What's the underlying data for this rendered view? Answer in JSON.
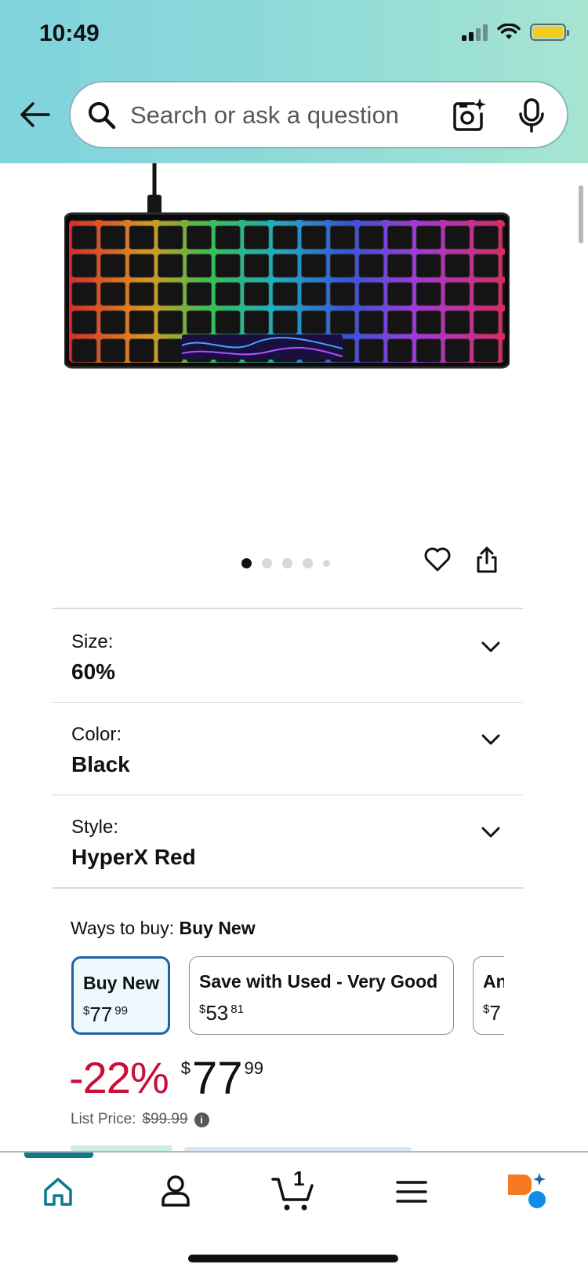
{
  "status_bar": {
    "time": "10:49"
  },
  "search": {
    "placeholder": "Search or ask a question"
  },
  "gallery": {
    "image_count": 5,
    "active_index": 0
  },
  "variations": [
    {
      "label": "Size:",
      "value": "60%"
    },
    {
      "label": "Color:",
      "value": "Black"
    },
    {
      "label": "Style:",
      "value": "HyperX Red"
    }
  ],
  "ways_to_buy": {
    "label": "Ways to buy:",
    "selected": "Buy New",
    "options": [
      {
        "title": "Buy New",
        "dollars": "77",
        "cents": "99",
        "currency": "$"
      },
      {
        "title": "Save with Used - Very Good",
        "dollars": "53",
        "cents": "81",
        "currency": "$"
      },
      {
        "title": "An",
        "dollars": "7",
        "cents": "",
        "currency": "$"
      }
    ]
  },
  "price": {
    "discount": "-22%",
    "currency": "$",
    "dollars": "77",
    "cents": "99",
    "list_label": "List Price:",
    "list_price": "$99.99"
  },
  "tabbar": {
    "cart_count": "1"
  },
  "colors": {
    "accent": "#0e7a8a",
    "discount": "#cc0c39",
    "selected_border": "#2162a1"
  }
}
